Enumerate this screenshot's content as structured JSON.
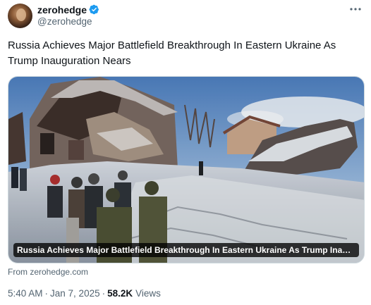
{
  "author": {
    "display_name": "zerohedge",
    "handle": "@zerohedge"
  },
  "tweet": {
    "text": "Russia Achieves Major Battlefield Breakthrough In Eastern Ukraine As Trump Inauguration Nears"
  },
  "card": {
    "caption": "Russia Achieves Major Battlefield Breakthrough In Eastern Ukraine As Trump Inaugurat...",
    "source": "From zerohedge.com"
  },
  "meta": {
    "time": "5:40 AM",
    "separator": "·",
    "date": "Jan 7, 2025",
    "separator2": "·",
    "views_count": "58.2K",
    "views_label": "Views"
  },
  "icons": {
    "verified": "verified-badge-icon",
    "more": "more-options-icon"
  },
  "colors": {
    "text_primary": "#0f1419",
    "text_secondary": "#536471",
    "verified_blue": "#1d9bf0",
    "border": "#cfd9de"
  }
}
